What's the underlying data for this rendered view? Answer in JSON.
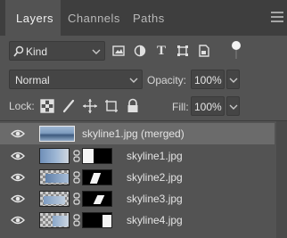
{
  "tabs": [
    {
      "label": "Layers",
      "active": true
    },
    {
      "label": "Channels",
      "active": false
    },
    {
      "label": "Paths",
      "active": false
    }
  ],
  "filter": {
    "kind_label": "Kind",
    "icons": [
      "image-filter-icon",
      "adjustment-filter-icon",
      "type-filter-icon",
      "shape-filter-icon",
      "smart-object-filter-icon"
    ],
    "type_glyph": "T"
  },
  "blend": {
    "mode": "Normal",
    "opacity_label": "Opacity:",
    "opacity_value": "100%"
  },
  "lock": {
    "label": "Lock:",
    "fill_label": "Fill:",
    "fill_value": "100%"
  },
  "layers": [
    {
      "name": "skyline1.jpg (merged)",
      "selected": true,
      "has_mask": false
    },
    {
      "name": "skyline1.jpg",
      "selected": false,
      "has_mask": true
    },
    {
      "name": "skyline2.jpg",
      "selected": false,
      "has_mask": true
    },
    {
      "name": "skyline3.jpg",
      "selected": false,
      "has_mask": true
    },
    {
      "name": "skyline4.jpg",
      "selected": false,
      "has_mask": true
    }
  ],
  "colors": {
    "panel_bg": "#535353",
    "tabbar_bg": "#3e3e3e",
    "selected_row": "#6b6b6b",
    "text": "#e4e4e4"
  }
}
